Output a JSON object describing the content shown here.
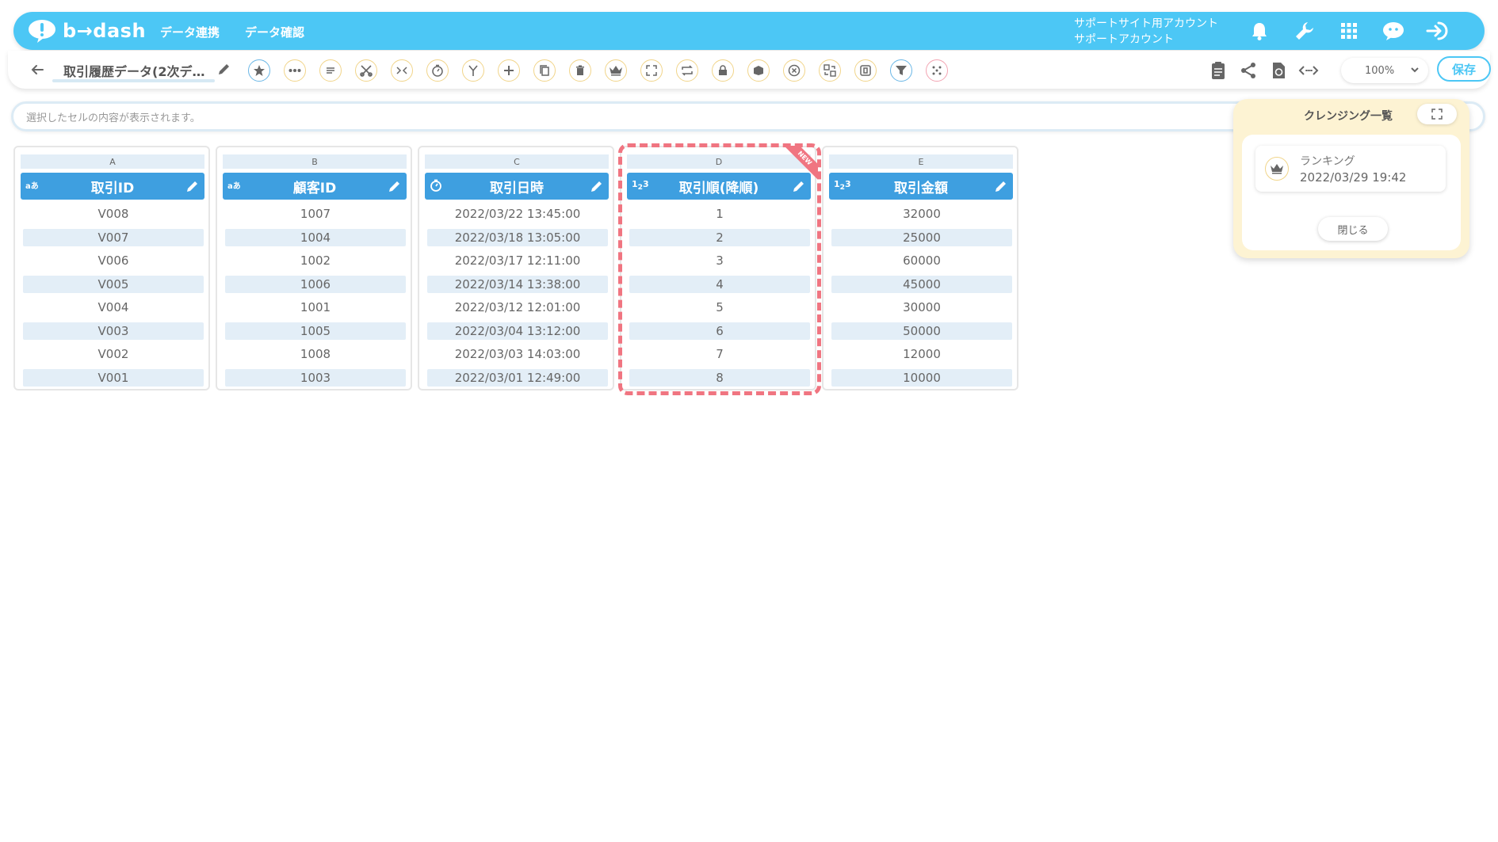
{
  "app": {
    "brand": "b→dash",
    "nav": [
      "データ連携",
      "データ確認"
    ],
    "account_line1": "サポートサイト用アカウント",
    "account_line2": "サポートアカウント",
    "accent_color": "#4cc7f5",
    "header_icons": [
      "bell-icon",
      "wrench-icon",
      "apps-grid-icon",
      "chat-icon",
      "logout-icon"
    ]
  },
  "toolbar": {
    "dataset_title": "取引履歴データ(2次デ…",
    "tools": [
      "star-icon",
      "more-horizontal-icon",
      "text-lines-icon",
      "scissors-icon",
      "merge-icon",
      "timer-icon",
      "branch-icon",
      "plus-icon",
      "copy-icon",
      "trash-icon",
      "crown-icon",
      "expand-icon",
      "loop-icon",
      "lock-icon",
      "box-icon",
      "close-circle-icon",
      "convert-icon",
      "frame-icon",
      "filter-icon",
      "dice-icon"
    ],
    "right_icons": [
      "clipboard-icon",
      "share-icon",
      "refresh-icon",
      "code-icon"
    ],
    "zoom": "100%",
    "save_label": "保存"
  },
  "cellbar": {
    "placeholder": "選択したセルの内容が表示されます。"
  },
  "columns": [
    {
      "letter": "A",
      "name": "取引ID",
      "type": "aあ",
      "values": [
        "V008",
        "V007",
        "V006",
        "V005",
        "V004",
        "V003",
        "V002",
        "V001"
      ]
    },
    {
      "letter": "B",
      "name": "顧客ID",
      "type": "aあ",
      "values": [
        "1007",
        "1004",
        "1002",
        "1006",
        "1001",
        "1005",
        "1008",
        "1003"
      ]
    },
    {
      "letter": "C",
      "name": "取引日時",
      "type": "timer",
      "values": [
        "2022/03/22 13:45:00",
        "2022/03/18 13:05:00",
        "2022/03/17 12:11:00",
        "2022/03/14 13:38:00",
        "2022/03/12 12:01:00",
        "2022/03/04 13:12:00",
        "2022/03/03 14:03:00",
        "2022/03/01 12:49:00"
      ]
    },
    {
      "letter": "D",
      "name": "取引順(降順)",
      "type": "123",
      "badge": "NEW",
      "values": [
        "1",
        "2",
        "3",
        "4",
        "5",
        "6",
        "7",
        "8"
      ]
    },
    {
      "letter": "E",
      "name": "取引金額",
      "type": "123",
      "values": [
        "32000",
        "25000",
        "60000",
        "45000",
        "30000",
        "50000",
        "12000",
        "10000"
      ]
    }
  ],
  "panel": {
    "title": "クレンジング一覧",
    "item_name": "ランキング",
    "item_date": "2022/03/29 19:42",
    "close_label": "閉じる"
  }
}
